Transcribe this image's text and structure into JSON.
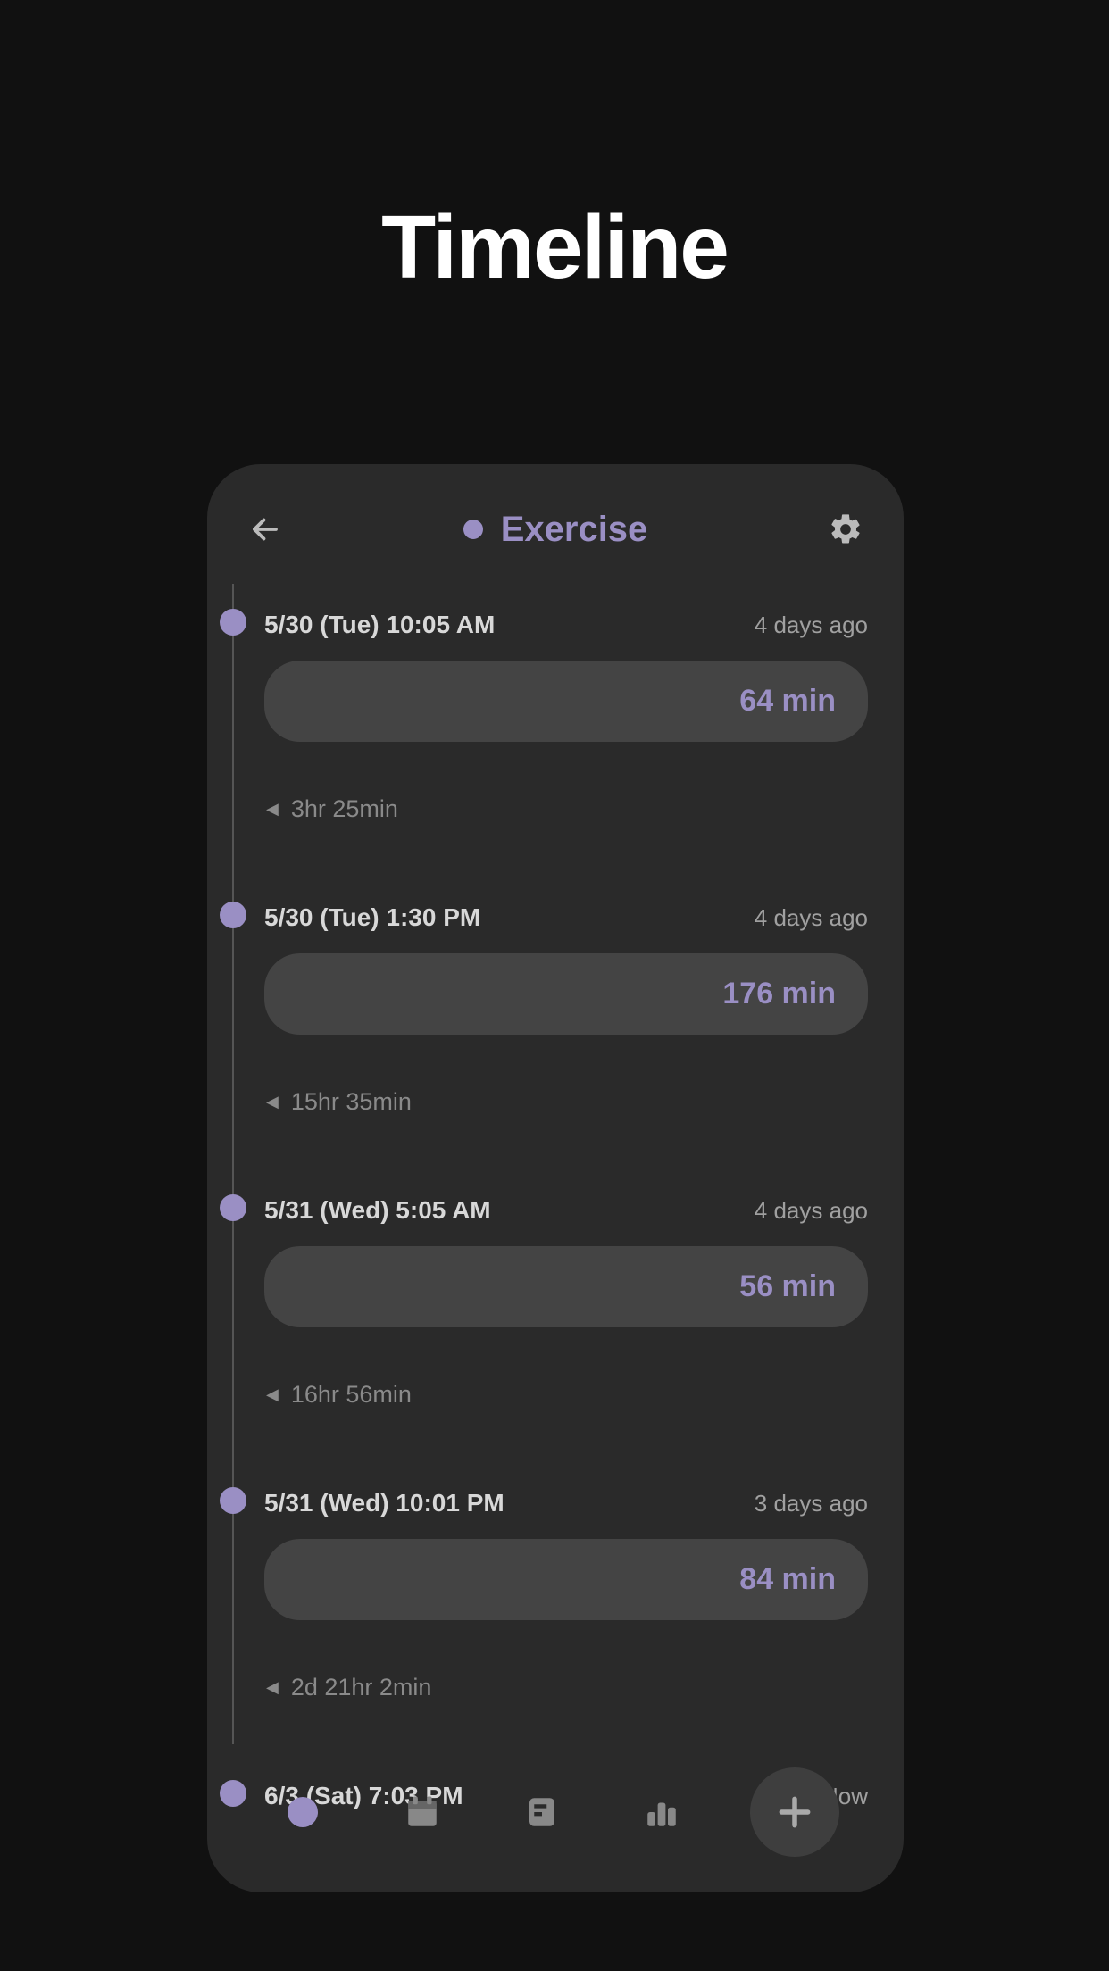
{
  "page": {
    "title": "Timeline"
  },
  "header": {
    "category": "Exercise"
  },
  "entries": [
    {
      "datetime": "5/30 (Tue)  10:05 AM",
      "relative": "4 days ago",
      "duration": "64 min",
      "gap_after": "3hr 25min"
    },
    {
      "datetime": "5/30 (Tue)  1:30 PM",
      "relative": "4 days ago",
      "duration": "176 min",
      "gap_after": "15hr 35min"
    },
    {
      "datetime": "5/31 (Wed)  5:05 AM",
      "relative": "4 days ago",
      "duration": "56 min",
      "gap_after": "16hr 56min"
    },
    {
      "datetime": "5/31 (Wed)  10:01 PM",
      "relative": "3 days ago",
      "duration": "84 min",
      "gap_after": "2d 21hr 2min"
    },
    {
      "datetime": "6/3 (Sat)  7:03 PM",
      "relative": "Now",
      "duration": null,
      "gap_after": null
    }
  ]
}
